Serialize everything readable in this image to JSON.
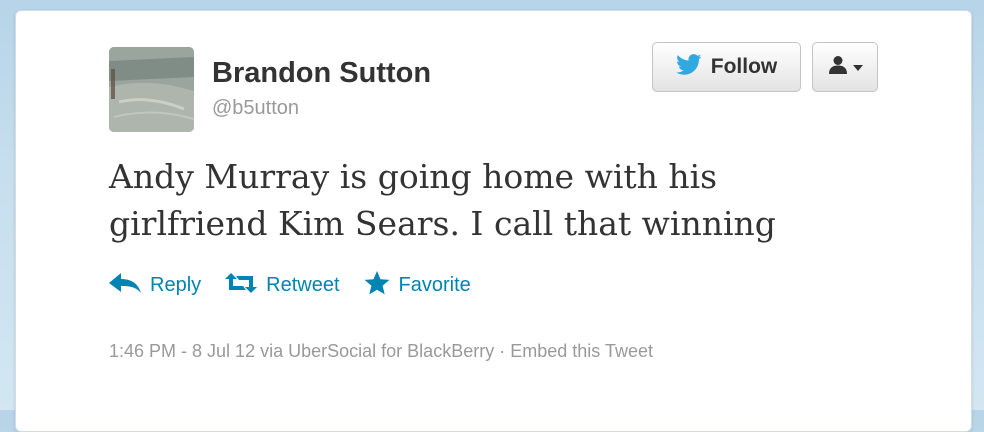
{
  "user": {
    "name": "Brandon Sutton",
    "handle": "@b5utton"
  },
  "buttons": {
    "follow_label": "Follow",
    "user_menu_icon": "user-dropdown-icon"
  },
  "tweet": {
    "text": "Andy Murray is going home with his girlfriend Kim Sears. I call that winning"
  },
  "actions": {
    "reply_label": "Reply",
    "retweet_label": "Retweet",
    "favorite_label": "Favorite"
  },
  "meta": {
    "timestamp": "1:46 PM - 8 Jul 12",
    "via_text": "via",
    "client": "UberSocial for BlackBerry",
    "separator": "·",
    "embed_label": "Embed this Tweet"
  },
  "colors": {
    "link": "#0084b4",
    "bird": "#2fa9e0",
    "text": "#333333",
    "muted": "#999999"
  }
}
